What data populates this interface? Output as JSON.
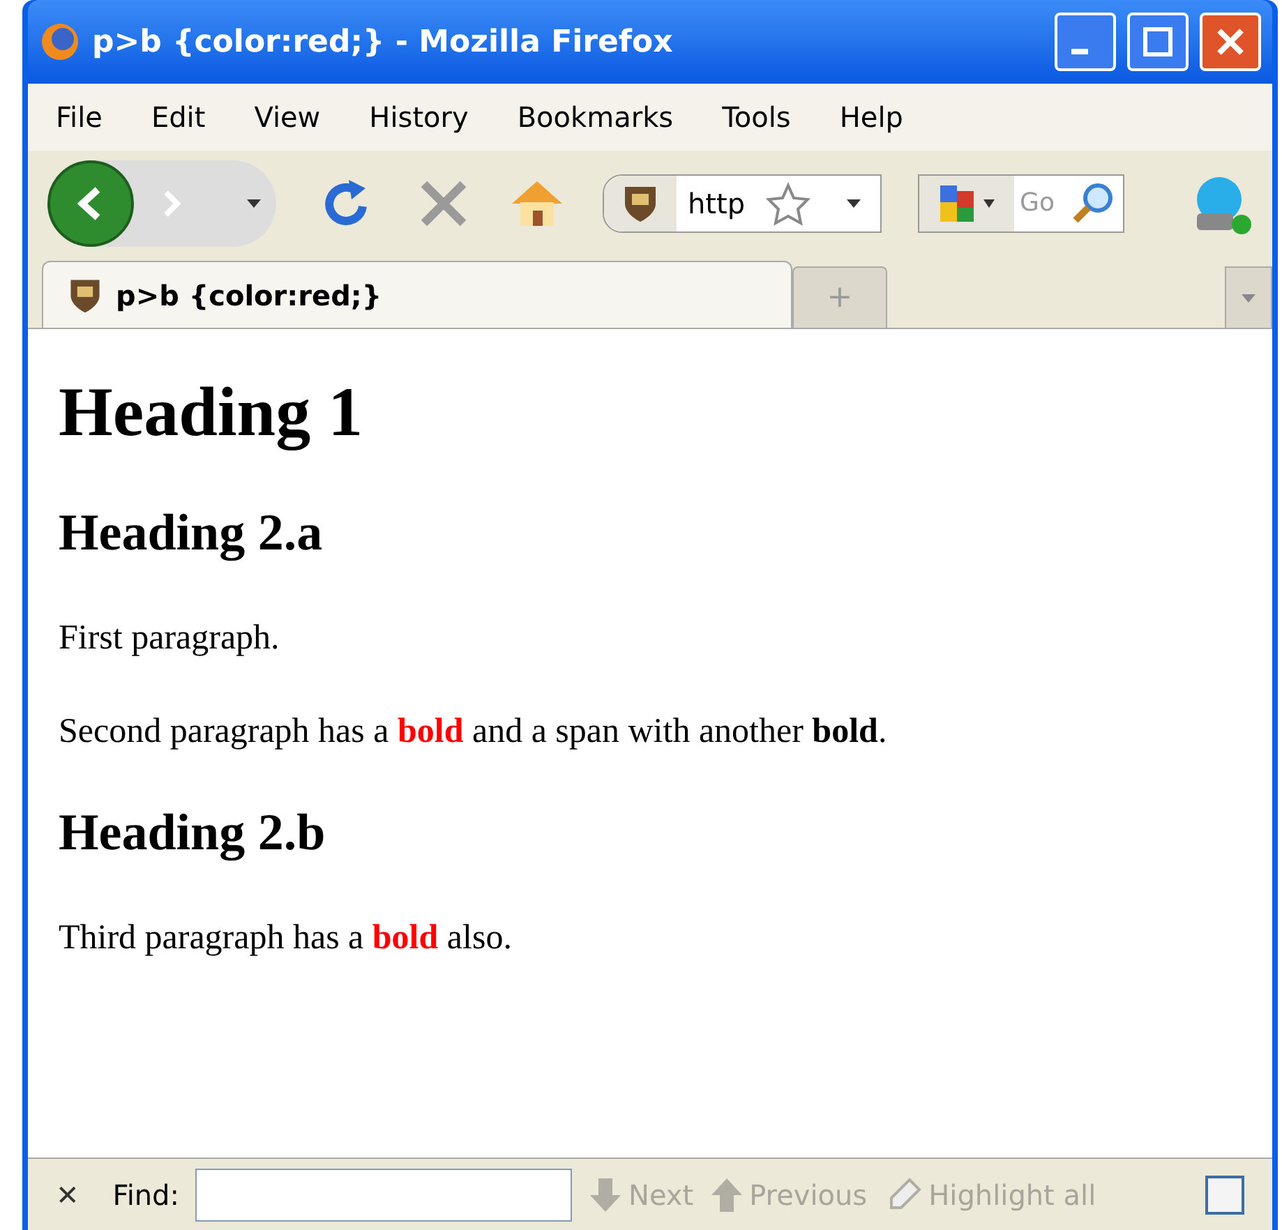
{
  "window": {
    "title": "p>b {color:red;} - Mozilla Firefox"
  },
  "menu": [
    "File",
    "Edit",
    "View",
    "History",
    "Bookmarks",
    "Tools",
    "Help"
  ],
  "address": {
    "value": "http"
  },
  "search": {
    "placeholder": "Go"
  },
  "tabs": [
    {
      "label": "p>b {color:red;}",
      "selected": true
    }
  ],
  "new_tab": "+",
  "content": [
    {
      "kind": "h1",
      "segments": [
        {
          "text": "Heading 1"
        }
      ]
    },
    {
      "kind": "h2",
      "segments": [
        {
          "text": "Heading 2.a"
        }
      ]
    },
    {
      "kind": "p",
      "segments": [
        {
          "text": "First paragraph."
        }
      ]
    },
    {
      "kind": "p",
      "segments": [
        {
          "text": "Second paragraph has a "
        },
        {
          "text": "bold",
          "bold": true,
          "color": "#ff0000"
        },
        {
          "text": " and a span with another "
        },
        {
          "text": "bold",
          "bold": true,
          "color": "#000000"
        },
        {
          "text": "."
        }
      ]
    },
    {
      "kind": "h2",
      "segments": [
        {
          "text": "Heading 2.b"
        }
      ]
    },
    {
      "kind": "p",
      "segments": [
        {
          "text": "Third paragraph has a "
        },
        {
          "text": "bold",
          "bold": true,
          "color": "#ff0000"
        },
        {
          "text": " also."
        }
      ]
    }
  ],
  "find_bar": {
    "close": "✕",
    "label": "Find:",
    "buttons": [
      {
        "label": "Next",
        "disabled": true
      },
      {
        "label": "Previous",
        "disabled": true
      },
      {
        "label": "Highlight all",
        "disabled": true
      }
    ]
  }
}
